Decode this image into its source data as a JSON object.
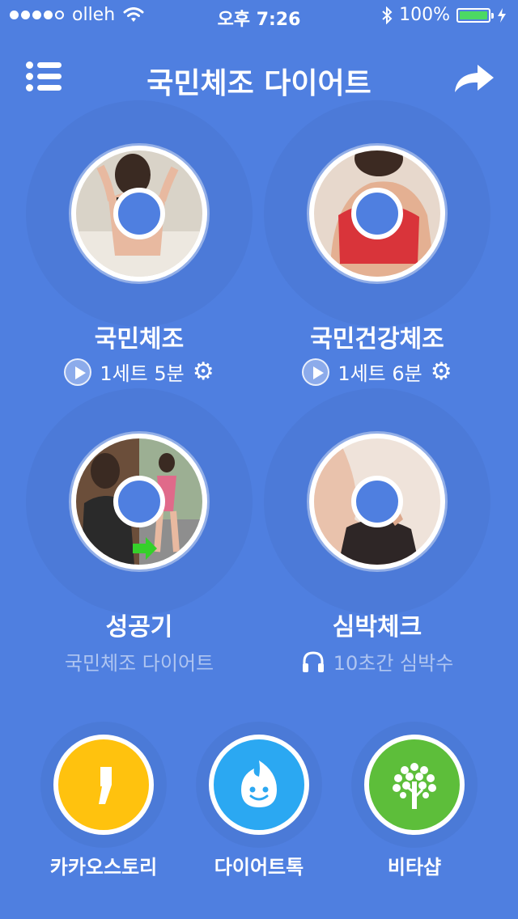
{
  "status": {
    "carrier": "olleh",
    "time": "오후 7:26",
    "battery_percent": "100%",
    "battery_level": 1.0
  },
  "header": {
    "title": "국민체조 다이어트",
    "menu_icon": "list-icon",
    "share_icon": "share-arrow-icon"
  },
  "cards": [
    {
      "title": "국민체조",
      "subtitle": "1세트 5분"
    },
    {
      "title": "국민건강체조",
      "subtitle": "1세트 6분"
    },
    {
      "title": "성공기",
      "subtitle": "국민체조 다이어트"
    },
    {
      "title": "심박체크",
      "subtitle": "10초간 심박수"
    }
  ],
  "apps": [
    {
      "label": "카카오스토리",
      "color": "#FFC20E"
    },
    {
      "label": "다이어트톡",
      "color": "#2BA8F2"
    },
    {
      "label": "비타샵",
      "color": "#5DBE3A"
    }
  ],
  "colors": {
    "background": "#4F7FE0",
    "battery": "#4CD964"
  }
}
